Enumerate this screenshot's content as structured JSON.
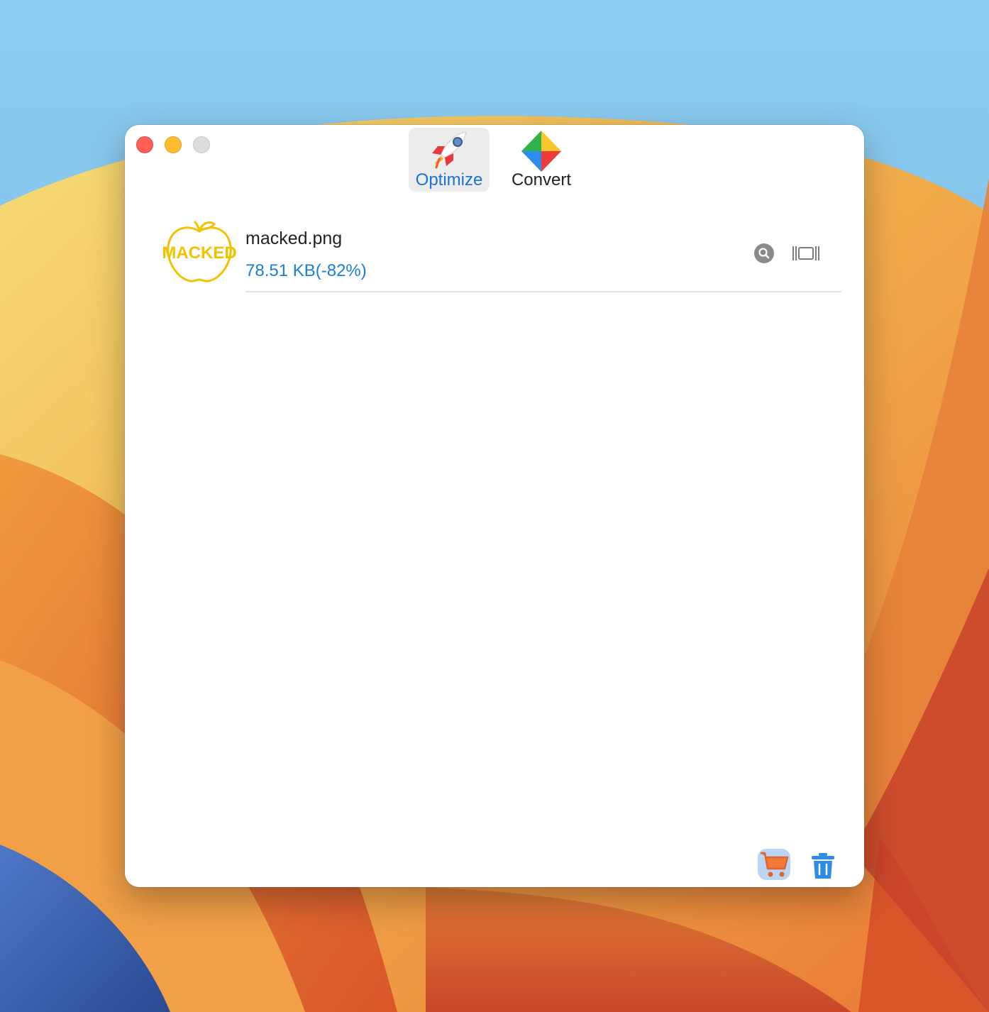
{
  "window": {
    "traffic_lights": [
      "close",
      "minimize",
      "zoom"
    ]
  },
  "toolbar": {
    "tabs": [
      {
        "label": "Optimize",
        "icon": "rocket-icon",
        "selected": true
      },
      {
        "label": "Convert",
        "icon": "color-pinwheel-icon",
        "selected": false
      }
    ]
  },
  "files": [
    {
      "thumbnail_text": "MACKED",
      "name": "macked.png",
      "size": "78.51 KB(-82%)",
      "actions": [
        "magnifier-icon",
        "compare-icon"
      ]
    }
  ],
  "bottom_bar": {
    "actions": [
      "shopping-cart-icon",
      "trash-icon"
    ]
  },
  "colors": {
    "accent_blue": "#1a7fd8",
    "thumb_yellow": "#f2c200",
    "tl_close": "#fe5f57",
    "tl_minimize": "#febc2e",
    "tl_zoom": "#dcdcdc"
  }
}
